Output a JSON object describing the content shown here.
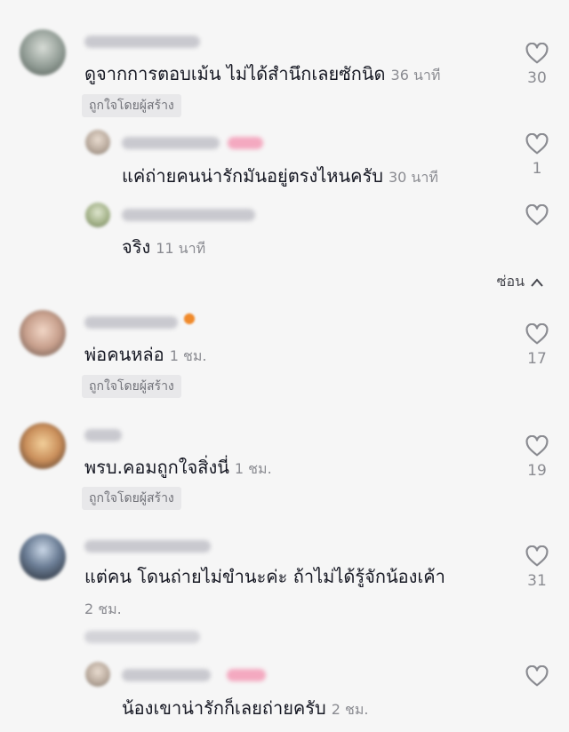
{
  "icons": {
    "like": "heart-outline-icon",
    "collapse": "chevron-up-icon"
  },
  "colors": {
    "text": "#161823",
    "muted": "#8a8b91",
    "badge_bg": "#e8e8ea"
  },
  "comments": [
    {
      "text": "ดูจากการตอบเม้น ไม่ได้สำนึกเลยซักนิด",
      "time": "36 นาที",
      "badge": "ถูกใจโดยผู้สร้าง",
      "likes": "30",
      "replies": [
        {
          "text": "แค่ถ่ายคนน่ารักมันอยู่ตรงไหนครับ",
          "time": "30 นาที",
          "likes": "1"
        },
        {
          "text": "จริง",
          "time": "11 นาที",
          "likes": ""
        }
      ],
      "hide_label": "ซ่อน"
    },
    {
      "text": "พ่อคนหล่อ",
      "time": "1 ชม.",
      "badge": "ถูกใจโดยผู้สร้าง",
      "likes": "17"
    },
    {
      "text": "พรบ.คอมถูกใจสิ่งนี่",
      "time": "1 ชม.",
      "badge": "ถูกใจโดยผู้สร้าง",
      "likes": "19"
    },
    {
      "text": "แต่คน โดนถ่ายไม่ขำนะค่ะ ถ้าไม่ได้รู้จักน้องเค้า",
      "time": "2 ชม.",
      "likes": "31",
      "replies": [
        {
          "text": "น้องเขาน่ารักก็เลยถ่ายครับ",
          "time": "2 ชม.",
          "likes": ""
        }
      ]
    }
  ]
}
